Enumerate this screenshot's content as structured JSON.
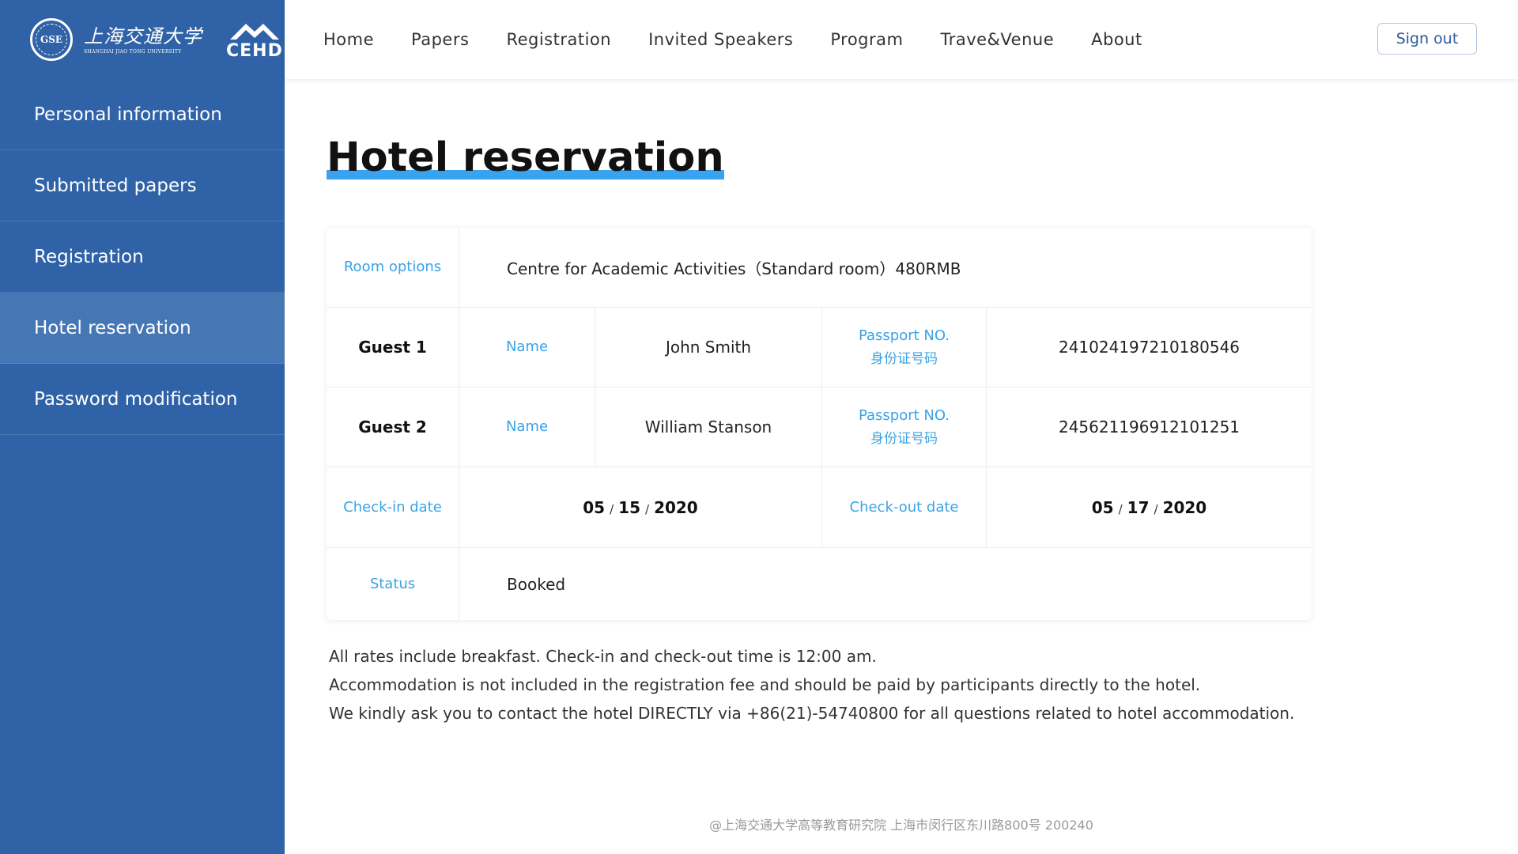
{
  "logo": {
    "seal_text": "GSE",
    "university_cn": "上海交通大学",
    "university_en": "SHANGHAI JIAO TONG UNIVERSITY",
    "brand": "CEHD"
  },
  "sidebar": {
    "items": [
      {
        "label": "Personal information"
      },
      {
        "label": "Submitted papers"
      },
      {
        "label": "Registration"
      },
      {
        "label": "Hotel reservation"
      },
      {
        "label": "Password modification"
      }
    ],
    "active_index": 3
  },
  "topnav": {
    "items": [
      {
        "label": "Home"
      },
      {
        "label": "Papers"
      },
      {
        "label": "Registration"
      },
      {
        "label": "Invited Speakers"
      },
      {
        "label": "Program"
      },
      {
        "label": "Trave&Venue"
      },
      {
        "label": "About"
      }
    ],
    "signout_label": "Sign out"
  },
  "page": {
    "title": "Hotel reservation"
  },
  "reservation": {
    "room_options_label": "Room options",
    "room_options_value": "Centre for Academic Activities（Standard room）480RMB",
    "guests": [
      {
        "title": "Guest 1",
        "name_label": "Name",
        "name": "John Smith",
        "passport_label": "Passport NO.",
        "passport_label_cn": "身份证号码",
        "passport": "241024197210180546"
      },
      {
        "title": "Guest 2",
        "name_label": "Name",
        "name": "William Stanson",
        "passport_label": "Passport NO.",
        "passport_label_cn": "身份证号码",
        "passport": "245621196912101251"
      }
    ],
    "checkin_label": "Check-in date",
    "checkin": {
      "month": "05",
      "day": "15",
      "year": "2020"
    },
    "checkout_label": "Check-out date",
    "checkout": {
      "month": "05",
      "day": "17",
      "year": "2020"
    },
    "date_separator": "/",
    "status_label": "Status",
    "status": "Booked"
  },
  "notes": [
    "All rates include breakfast. Check-in and check-out time is 12:00 am.",
    "Accommodation is not included in the registration fee and should be paid by participants directly to the hotel.",
    "We kindly ask you to contact the hotel DIRECTLY via +86(21)-54740800 for all questions related to hotel accommodation."
  ],
  "footer": {
    "text": "@上海交通大学高等教育研究院   上海市闵行区东川路800号   200240"
  },
  "colors": {
    "sidebar_bg": "#2f62a6",
    "sidebar_active": "#4577b5",
    "accent_blue": "#3aa3e6",
    "title_underline": "#3aa3f0"
  }
}
